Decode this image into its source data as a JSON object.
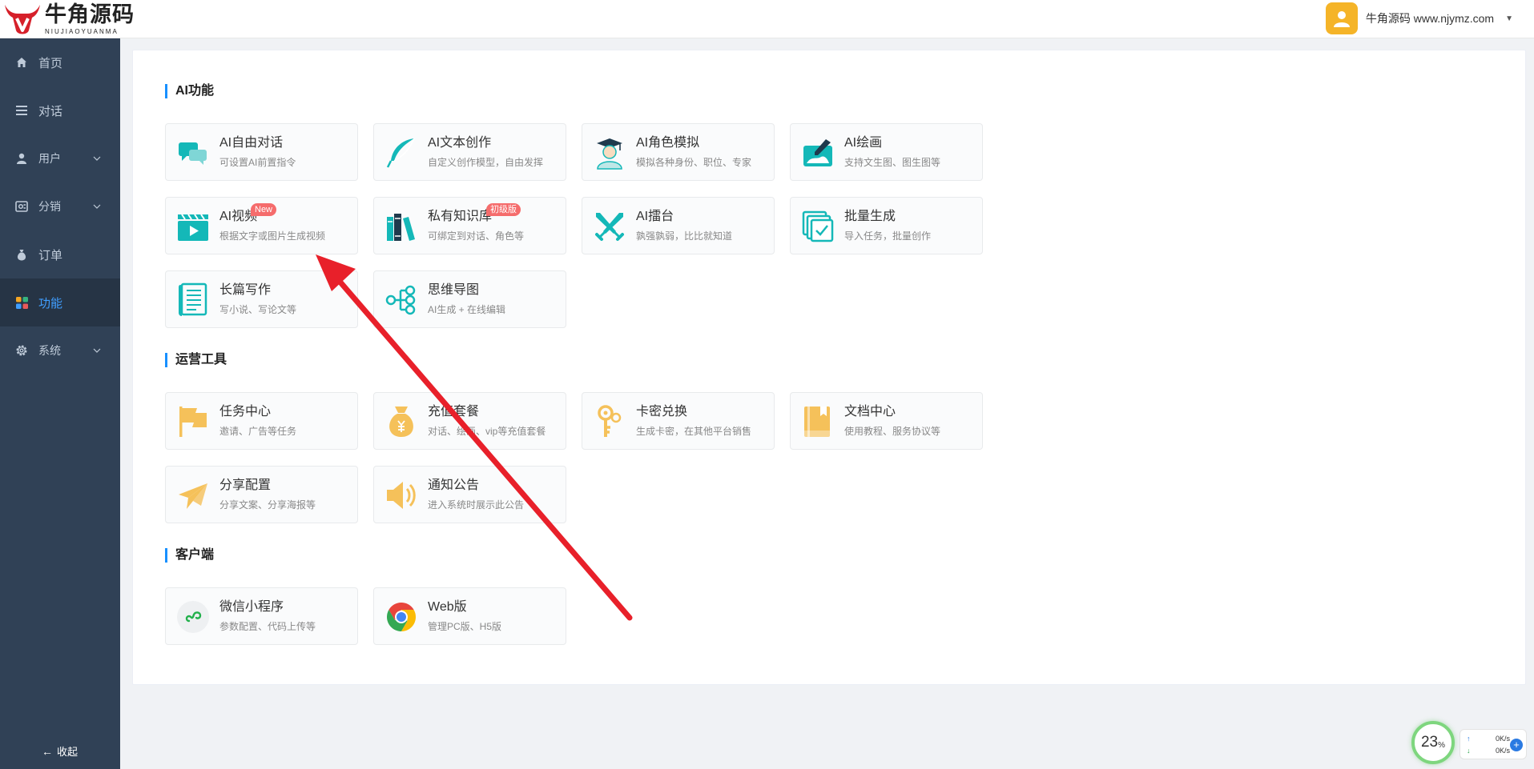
{
  "header": {
    "logo_title": "牛角源码",
    "logo_subtitle": "NIUJIAOYUANMA",
    "user_name": "牛角源码 www.njymz.com"
  },
  "sidebar": {
    "items": [
      {
        "label": "首页",
        "icon": "home-icon"
      },
      {
        "label": "对话",
        "icon": "list-icon"
      },
      {
        "label": "用户",
        "icon": "user-icon"
      },
      {
        "label": "分销",
        "icon": "distribution-icon"
      },
      {
        "label": "订单",
        "icon": "money-bag-icon"
      },
      {
        "label": "功能",
        "icon": "grid-icon",
        "active": true
      },
      {
        "label": "系统",
        "icon": "gear-icon"
      }
    ],
    "collapse_label": "收起"
  },
  "sections": [
    {
      "title": "AI功能",
      "cards": [
        {
          "title": "AI自由对话",
          "desc": "可设置AI前置指令",
          "icon": "chat-bubbles-icon"
        },
        {
          "title": "AI文本创作",
          "desc": "自定义创作模型，自由发挥",
          "icon": "feather-icon"
        },
        {
          "title": "AI角色模拟",
          "desc": "模拟各种身份、职位、专家",
          "icon": "graduate-icon"
        },
        {
          "title": "AI绘画",
          "desc": "支持文生图、图生图等",
          "icon": "paint-icon"
        },
        {
          "title": "AI视频",
          "desc": "根据文字或图片生成视频",
          "icon": "video-clapper-icon",
          "badge": "New"
        },
        {
          "title": "私有知识库",
          "desc": "可绑定到对话、角色等",
          "icon": "books-icon",
          "badge": "初级版"
        },
        {
          "title": "AI擂台",
          "desc": "孰强孰弱，比比就知道",
          "icon": "crossed-swords-icon"
        },
        {
          "title": "批量生成",
          "desc": "导入任务，批量创作",
          "icon": "batch-icon"
        },
        {
          "title": "长篇写作",
          "desc": "写小说、写论文等",
          "icon": "scroll-icon"
        },
        {
          "title": "思维导图",
          "desc": "AI生成 + 在线编辑",
          "icon": "mindmap-icon"
        }
      ]
    },
    {
      "title": "运营工具",
      "cards": [
        {
          "title": "任务中心",
          "desc": "邀请、广告等任务",
          "icon": "flag-icon"
        },
        {
          "title": "充值套餐",
          "desc": "对话、绘画、vip等充值套餐",
          "icon": "money-bag-icon"
        },
        {
          "title": "卡密兑换",
          "desc": "生成卡密，在其他平台销售",
          "icon": "key-icon"
        },
        {
          "title": "文档中心",
          "desc": "使用教程、服务协议等",
          "icon": "document-icon"
        },
        {
          "title": "分享配置",
          "desc": "分享文案、分享海报等",
          "icon": "paper-plane-icon"
        },
        {
          "title": "通知公告",
          "desc": "进入系统时展示此公告",
          "icon": "speaker-icon"
        }
      ]
    },
    {
      "title": "客户端",
      "cards": [
        {
          "title": "微信小程序",
          "desc": "参数配置、代码上传等",
          "icon": "mini-program-icon"
        },
        {
          "title": "Web版",
          "desc": "管理PC版、H5版",
          "icon": "chrome-icon"
        }
      ]
    }
  ],
  "speed_widget": {
    "percent": "23",
    "percent_sign": "%",
    "upload": "0K/s",
    "download": "0K/s"
  },
  "colors": {
    "sidebar_bg": "#304156",
    "sidebar_active_bg": "#263445",
    "accent": "#409eff",
    "teal": "#14b8b8",
    "gold": "#f5c15a",
    "annotation": "#e8202a"
  }
}
